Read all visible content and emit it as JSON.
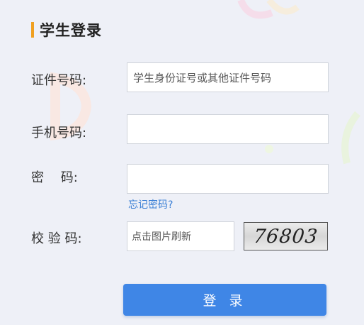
{
  "title": "学生登录",
  "fields": {
    "id_label": "证件号码:",
    "id_placeholder": "学生身份证号或其他证件号码",
    "phone_label": "手机号码:",
    "phone_value": "",
    "password_label": "密　 码:",
    "password_value": "",
    "forgot_link": "忘记密码?",
    "captcha_label": "校 验 码:",
    "captcha_placeholder": "点击图片刷新",
    "captcha_code": "76803"
  },
  "login_button": "登 录",
  "colors": {
    "accent": "#f0a020",
    "primary": "#3f86e6",
    "link": "#3a7fd5",
    "background": "#eef0f7"
  }
}
